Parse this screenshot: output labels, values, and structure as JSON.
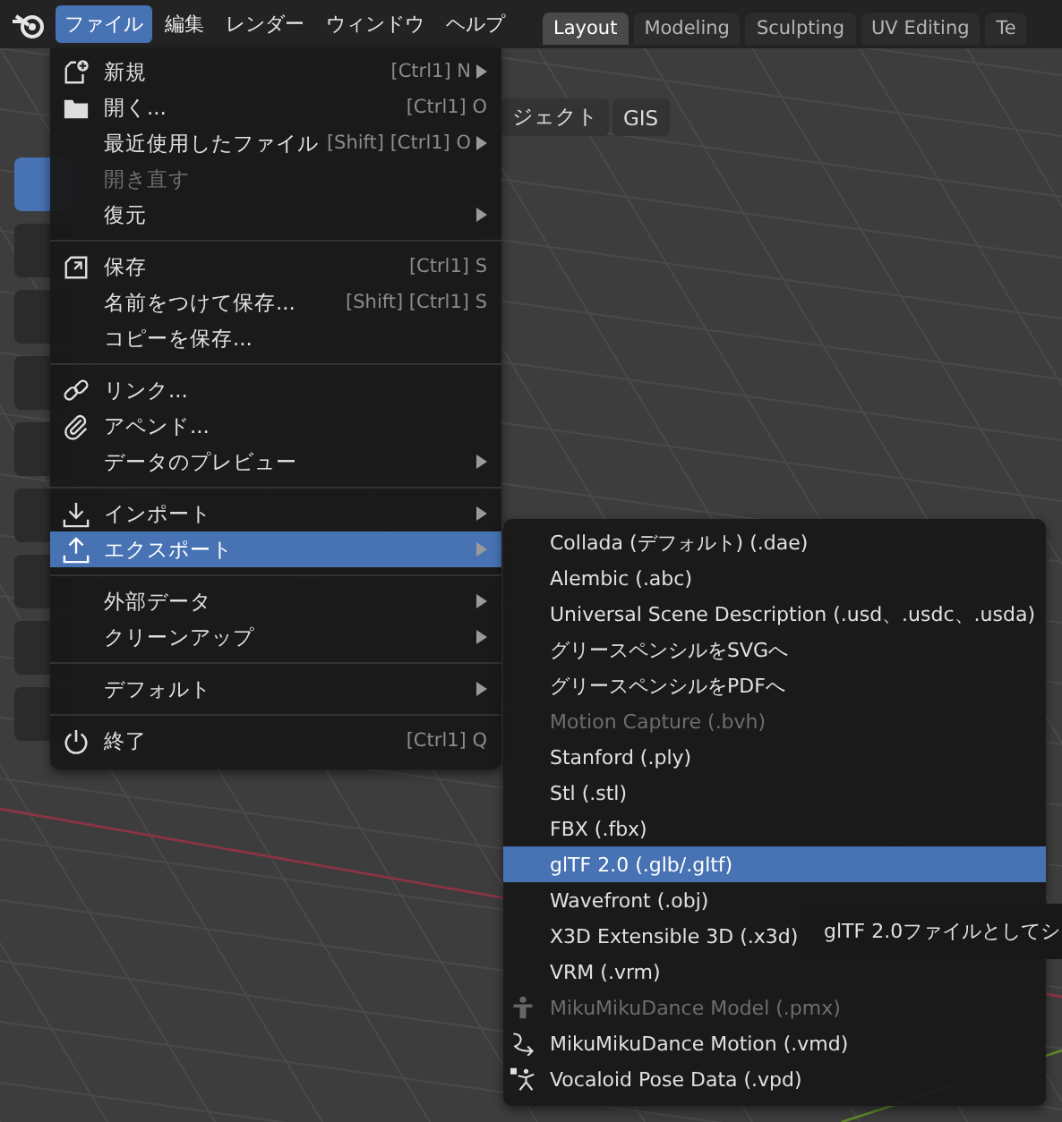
{
  "topbar": {
    "menus": [
      {
        "label": "ファイル",
        "selected": true
      },
      {
        "label": "編集",
        "selected": false
      },
      {
        "label": "レンダー",
        "selected": false
      },
      {
        "label": "ウィンドウ",
        "selected": false
      },
      {
        "label": "ヘルプ",
        "selected": false
      }
    ],
    "workspaces": [
      {
        "label": "Layout",
        "selected": true
      },
      {
        "label": "Modeling",
        "selected": false
      },
      {
        "label": "Sculpting",
        "selected": false
      },
      {
        "label": "UV Editing",
        "selected": false
      },
      {
        "label": "Te",
        "selected": false
      }
    ]
  },
  "viewport": {
    "header_buttons": [
      "ジェクト",
      "GIS"
    ]
  },
  "file_menu": {
    "sections": [
      [
        {
          "label": "新規",
          "shortcut": "[Ctrl1] N",
          "submenu": true,
          "disabled": false,
          "selected": false
        },
        {
          "label": "開く...",
          "shortcut": "[Ctrl1] O",
          "submenu": false,
          "disabled": false,
          "selected": false
        },
        {
          "label": "最近使用したファイル",
          "shortcut": "[Shift] [Ctrl1] O",
          "submenu": true,
          "disabled": false,
          "selected": false
        },
        {
          "label": "開き直す",
          "submenu": false,
          "disabled": true,
          "selected": false
        },
        {
          "label": "復元",
          "submenu": true,
          "disabled": false,
          "selected": false
        }
      ],
      [
        {
          "label": "保存",
          "shortcut": "[Ctrl1] S",
          "submenu": false,
          "disabled": false,
          "selected": false
        },
        {
          "label": "名前をつけて保存...",
          "shortcut": "[Shift] [Ctrl1] S",
          "submenu": false,
          "disabled": false,
          "selected": false
        },
        {
          "label": "コピーを保存...",
          "submenu": false,
          "disabled": false,
          "selected": false
        }
      ],
      [
        {
          "label": "リンク...",
          "submenu": false,
          "disabled": false,
          "selected": false
        },
        {
          "label": "アペンド...",
          "submenu": false,
          "disabled": false,
          "selected": false
        },
        {
          "label": "データのプレビュー",
          "submenu": true,
          "disabled": false,
          "selected": false
        }
      ],
      [
        {
          "label": "インポート",
          "submenu": true,
          "disabled": false,
          "selected": false
        },
        {
          "label": "エクスポート",
          "submenu": true,
          "disabled": false,
          "selected": true
        }
      ],
      [
        {
          "label": "外部データ",
          "submenu": true,
          "disabled": false,
          "selected": false
        },
        {
          "label": "クリーンアップ",
          "submenu": true,
          "disabled": false,
          "selected": false
        }
      ],
      [
        {
          "label": "デフォルト",
          "submenu": true,
          "disabled": false,
          "selected": false
        }
      ],
      [
        {
          "label": "終了",
          "shortcut": "[Ctrl1] Q",
          "submenu": false,
          "disabled": false,
          "selected": false
        }
      ]
    ]
  },
  "export_menu": {
    "items": [
      {
        "label": "Collada (デフォルト) (.dae)",
        "disabled": false,
        "selected": false
      },
      {
        "label": "Alembic (.abc)",
        "disabled": false,
        "selected": false
      },
      {
        "label": "Universal Scene Description (.usd、.usdc、.usda)",
        "disabled": false,
        "selected": false
      },
      {
        "label": "グリースペンシルをSVGへ",
        "disabled": false,
        "selected": false
      },
      {
        "label": "グリースペンシルをPDFへ",
        "disabled": false,
        "selected": false
      },
      {
        "label": "Motion Capture (.bvh)",
        "disabled": true,
        "selected": false
      },
      {
        "label": "Stanford (.ply)",
        "disabled": false,
        "selected": false
      },
      {
        "label": "Stl (.stl)",
        "disabled": false,
        "selected": false
      },
      {
        "label": "FBX (.fbx)",
        "disabled": false,
        "selected": false
      },
      {
        "label": "glTF 2.0 (.glb/.gltf)",
        "disabled": false,
        "selected": true
      },
      {
        "label": "Wavefront (.obj)",
        "disabled": false,
        "selected": false
      },
      {
        "label": "X3D Extensible 3D (.x3d)",
        "disabled": false,
        "selected": false
      },
      {
        "label": "VRM (.vrm)",
        "disabled": false,
        "selected": false
      },
      {
        "label": "MikuMikuDance Model (.pmx)",
        "disabled": true,
        "selected": false
      },
      {
        "label": "MikuMikuDance Motion (.vmd)",
        "disabled": false,
        "selected": false
      },
      {
        "label": "Vocaloid Pose Data (.vpd)",
        "disabled": false,
        "selected": false
      }
    ]
  },
  "tooltip": {
    "text": "glTF 2.0ファイルとしてシ"
  }
}
